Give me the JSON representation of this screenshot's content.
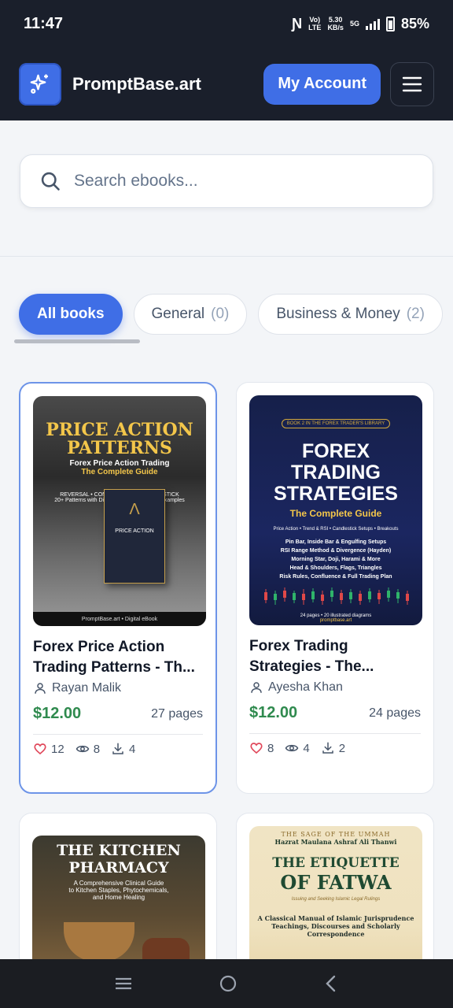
{
  "status": {
    "time": "11:47",
    "net_top": "Vo)",
    "net_bottom": "LTE",
    "speed_top": "5.30",
    "speed_bottom": "KB/s",
    "gen": "5G",
    "battery": "85%"
  },
  "header": {
    "brand": "PromptBase.art",
    "account_label": "My Account"
  },
  "search": {
    "placeholder": "Search ebooks..."
  },
  "categories": [
    {
      "label": "All books",
      "count": ""
    },
    {
      "label": "General",
      "count": "(0)"
    },
    {
      "label": "Business & Money",
      "count": "(2)"
    }
  ],
  "books": [
    {
      "title_line1": "Forex Price Action",
      "title_line2": "Trading Patterns - Th...",
      "author": "Rayan Malik",
      "price": "$12.00",
      "pages": "27 pages",
      "likes": "12",
      "views": "8",
      "downloads": "4",
      "cover": {
        "title1": "PRICE ACTION",
        "title2": "PATTERNS",
        "subtitle1": "Forex Price Action Trading",
        "subtitle2": "The Complete Guide",
        "tags": "REVERSAL • CONTINUATION • CANDLESTICK",
        "tagline": "20+ Patterns with Diagrams, Entry Rules & Examples",
        "book_label": "PRICE ACTION",
        "footer": "PromptBase.art • Digital eBook"
      }
    },
    {
      "title_line1": "Forex Trading",
      "title_line2": "Strategies - The...",
      "author": "Ayesha Khan",
      "price": "$12.00",
      "pages": "24 pages",
      "likes": "8",
      "views": "4",
      "downloads": "2",
      "cover": {
        "badge": "BOOK 2 IN THE FOREX TRADER'S LIBRARY",
        "title1": "FOREX",
        "title2": "TRADING",
        "title3": "STRATEGIES",
        "subtitle": "The Complete Guide",
        "topics": "Price Action • Trend & RSI • Candlestick Setups • Breakouts",
        "lines": [
          "Pin Bar, Inside Bar & Engulfing Setups",
          "RSI Range Method & Divergence (Hayden)",
          "Morning Star, Doji, Harami & More",
          "Head & Shoulders, Flags, Triangles",
          "Risk Rules, Confluence & Full Trading Plan"
        ],
        "meta": "24 pages • 20 illustrated diagrams",
        "site": "promptbase.art"
      }
    },
    {
      "cover": {
        "title1": "THE KITCHEN",
        "title2": "PHARMACY",
        "sub1": "A Comprehensive Clinical Guide",
        "sub2": "to Kitchen Staples, Phytochemicals,",
        "sub3": "and Home Healing"
      }
    },
    {
      "cover": {
        "top": "THE SAGE OF THE UMMAH",
        "author": "Hazrat Maulana Ashraf Ali Thanwi",
        "title1": "THE ETIQUETTE",
        "title2": "OF FATWA",
        "tag": "Issuing and Seeking Islamic Legal Rulings",
        "desc1": "A Classical Manual of Islamic Jurisprudence",
        "desc2": "Teachings, Discourses and Scholarly",
        "desc3": "Correspondence"
      }
    }
  ]
}
